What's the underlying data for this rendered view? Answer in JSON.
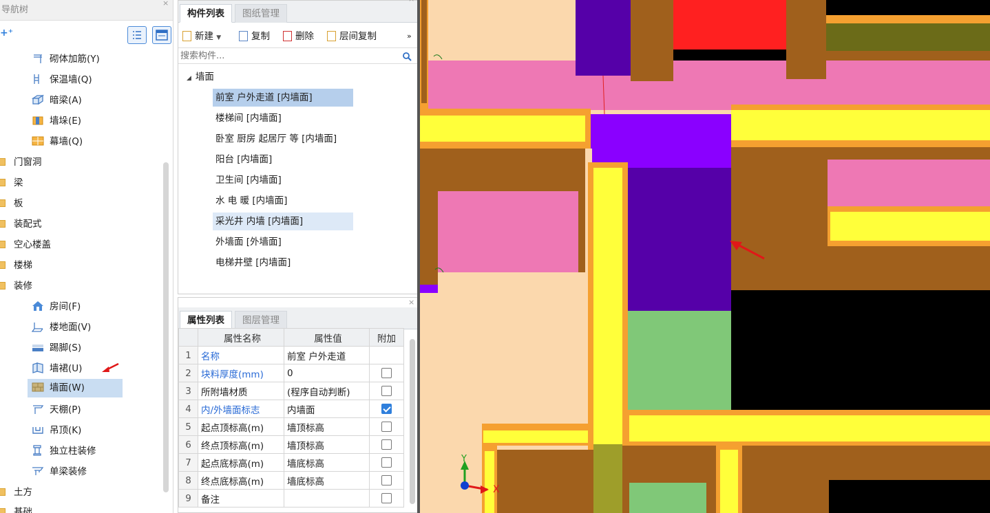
{
  "nav": {
    "title": "导航树",
    "items": [
      {
        "label": "砌体加筋(Y)",
        "icon": "masonry-rebar-icon"
      },
      {
        "label": "保温墙(Q)",
        "icon": "insulation-wall-icon"
      },
      {
        "label": "暗梁(A)",
        "icon": "hidden-beam-icon"
      },
      {
        "label": "墙垛(E)",
        "icon": "wall-pier-icon"
      },
      {
        "label": "幕墙(Q)",
        "icon": "curtain-wall-icon"
      }
    ],
    "folders": [
      "门窗洞",
      "梁",
      "板",
      "装配式",
      "空心楼盖",
      "楼梯",
      "装修"
    ],
    "finish_items": [
      {
        "label": "房间(F)",
        "icon": "room-icon"
      },
      {
        "label": "楼地面(V)",
        "icon": "floor-icon"
      },
      {
        "label": "踢脚(S)",
        "icon": "skirting-icon"
      },
      {
        "label": "墙裙(U)",
        "icon": "dado-icon"
      },
      {
        "label": "墙面(W)",
        "icon": "wall-surface-icon"
      },
      {
        "label": "天棚(P)",
        "icon": "ceiling-icon"
      },
      {
        "label": "吊顶(K)",
        "icon": "suspended-ceiling-icon"
      },
      {
        "label": "独立柱装修",
        "icon": "column-finish-icon"
      },
      {
        "label": "单梁装修",
        "icon": "beam-finish-icon"
      }
    ],
    "after_folders": [
      "土方",
      "基础"
    ]
  },
  "components": {
    "tabs": [
      "构件列表",
      "图纸管理"
    ],
    "toolbar": {
      "new": "新建",
      "copy": "复制",
      "delete": "删除",
      "layer_copy": "层间复制",
      "more": "»"
    },
    "search_placeholder": "搜索构件...",
    "group": "墙面",
    "items": [
      "前室  户外走道 [内墙面]",
      "楼梯间 [内墙面]",
      "卧室 厨房 起居厅 等 [内墙面]",
      "阳台 [内墙面]",
      "卫生间 [内墙面]",
      "水 电 暖 [内墙面]",
      "采光井 内墙 [内墙面]",
      "外墙面 [外墙面]",
      "电梯井壁 [内墙面]"
    ]
  },
  "properties": {
    "tabs": [
      "属性列表",
      "图层管理"
    ],
    "headers": [
      "属性名称",
      "属性值",
      "附加"
    ],
    "rows": [
      {
        "no": "1",
        "name": "名称",
        "value": "前室  户外走道",
        "blue": true,
        "checkbox": "none"
      },
      {
        "no": "2",
        "name": "块料厚度(mm)",
        "value": "0",
        "blue": true,
        "checkbox": "off"
      },
      {
        "no": "3",
        "name": "所附墙材质",
        "value": "(程序自动判断)",
        "blue": false,
        "checkbox": "off"
      },
      {
        "no": "4",
        "name": "内/外墙面标志",
        "value": "内墙面",
        "blue": true,
        "checkbox": "on"
      },
      {
        "no": "5",
        "name": "起点顶标高(m)",
        "value": "墙顶标高",
        "blue": false,
        "checkbox": "off"
      },
      {
        "no": "6",
        "name": "终点顶标高(m)",
        "value": "墙顶标高",
        "blue": false,
        "checkbox": "off"
      },
      {
        "no": "7",
        "name": "起点底标高(m)",
        "value": "墙底标高",
        "blue": false,
        "checkbox": "off"
      },
      {
        "no": "8",
        "name": "终点底标高(m)",
        "value": "墙底标高",
        "blue": false,
        "checkbox": "off"
      },
      {
        "no": "9",
        "name": "备注",
        "value": "",
        "blue": false,
        "checkbox": "off"
      }
    ]
  },
  "canvas": {
    "axis_x": "X",
    "axis_y": "Y",
    "colors": {
      "brown": "#a0601c",
      "orange": "#f5a030",
      "yellow": "#ffff3a",
      "pink": "#ee78b4",
      "purple": "#5500a8",
      "violet": "#8a00ff",
      "green": "#80c878",
      "red": "#ff2020",
      "olive": "#6b6b18",
      "black": "#000000",
      "peach": "#fbd8ad"
    }
  }
}
